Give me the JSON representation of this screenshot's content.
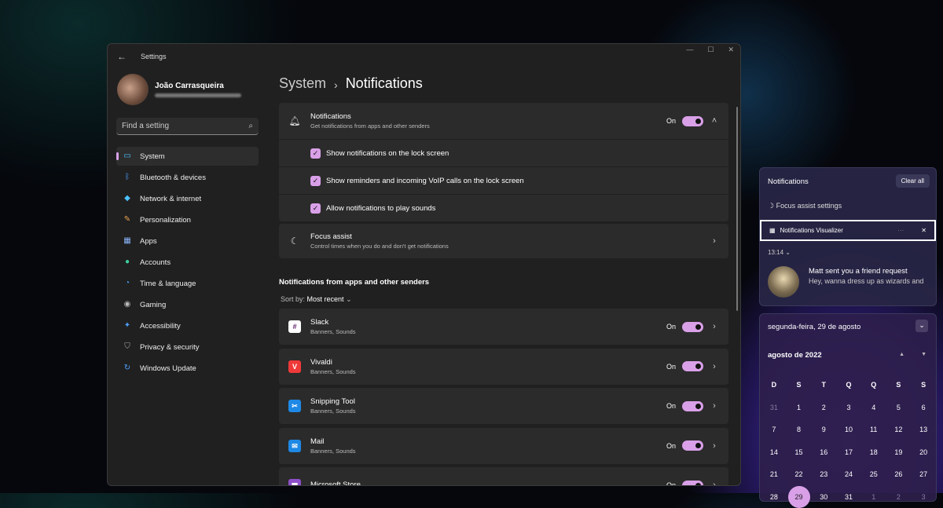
{
  "window": {
    "title": "Settings",
    "back": "←",
    "min": "—",
    "max": "☐",
    "close": "✕"
  },
  "profile": {
    "name": "João Carrasqueira"
  },
  "search": {
    "placeholder": "Find a setting",
    "icon": "⌕"
  },
  "nav": [
    {
      "label": "System",
      "icon": "▭",
      "color": "#4cc2ff"
    },
    {
      "label": "Bluetooth & devices",
      "icon": "ᛒ",
      "color": "#4ca0ff"
    },
    {
      "label": "Network & internet",
      "icon": "◆",
      "color": "#4cc2ff"
    },
    {
      "label": "Personalization",
      "icon": "✎",
      "color": "#e8a050"
    },
    {
      "label": "Apps",
      "icon": "▦",
      "color": "#8ab4f8"
    },
    {
      "label": "Accounts",
      "icon": "●",
      "color": "#3ccf9a"
    },
    {
      "label": "Time & language",
      "icon": "◔",
      "color": "#4ca0ff"
    },
    {
      "label": "Gaming",
      "icon": "◉",
      "color": "#bbbbbb"
    },
    {
      "label": "Accessibility",
      "icon": "✦",
      "color": "#4ca0ff"
    },
    {
      "label": "Privacy & security",
      "icon": "⛉",
      "color": "#aaaaaa"
    },
    {
      "label": "Windows Update",
      "icon": "↻",
      "color": "#4ca0ff"
    }
  ],
  "breadcrumb": {
    "parent": "System",
    "sep": "›",
    "current": "Notifications"
  },
  "notifications": {
    "title": "Notifications",
    "subtitle": "Get notifications from apps and other senders",
    "state": "On",
    "options": [
      "Show notifications on the lock screen",
      "Show reminders and incoming VoIP calls on the lock screen",
      "Allow notifications to play sounds"
    ]
  },
  "focus": {
    "title": "Focus assist",
    "subtitle": "Control times when you do and don't get notifications"
  },
  "apps_section": {
    "title": "Notifications from apps and other senders",
    "sort_label": "Sort by:",
    "sort_value": "Most recent"
  },
  "apps": [
    {
      "name": "Slack",
      "detail": "Banners, Sounds",
      "state": "On",
      "icon": "#",
      "bg": "#ffffff",
      "fg": "#611f69"
    },
    {
      "name": "Vivaldi",
      "detail": "Banners, Sounds",
      "state": "On",
      "icon": "V",
      "bg": "#ef3939",
      "fg": "#ffffff"
    },
    {
      "name": "Snipping Tool",
      "detail": "Banners, Sounds",
      "state": "On",
      "icon": "✂",
      "bg": "#1e88e5",
      "fg": "#ffffff"
    },
    {
      "name": "Mail",
      "detail": "Banners, Sounds",
      "state": "On",
      "icon": "✉",
      "bg": "#1e88e5",
      "fg": "#ffffff"
    },
    {
      "name": "Microsoft Store",
      "detail": "",
      "state": "On",
      "icon": "▦",
      "bg": "#8e4fc9",
      "fg": "#ffffff"
    }
  ],
  "panel": {
    "title": "Notifications",
    "clear": "Clear all",
    "focus": "Focus assist settings",
    "app": "Notifications Visualizer",
    "more": "···",
    "time": "13:14",
    "msg_title": "Matt sent you a friend request",
    "msg_body": "Hey, wanna dress up as wizards and"
  },
  "calendar": {
    "date": "segunda-feira, 29 de agosto",
    "month": "agosto de 2022",
    "days": [
      "D",
      "S",
      "T",
      "Q",
      "Q",
      "S",
      "S"
    ],
    "dates": [
      "31",
      "1",
      "2",
      "3",
      "4",
      "5",
      "6",
      "7",
      "8",
      "9",
      "10",
      "11",
      "12",
      "13",
      "14",
      "15",
      "16",
      "17",
      "18",
      "19",
      "20",
      "21",
      "22",
      "23",
      "24",
      "25",
      "26",
      "27",
      "28",
      "29",
      "30",
      "31",
      "1",
      "2",
      "3"
    ],
    "selected": "29"
  },
  "accent": "#d9a0e8"
}
